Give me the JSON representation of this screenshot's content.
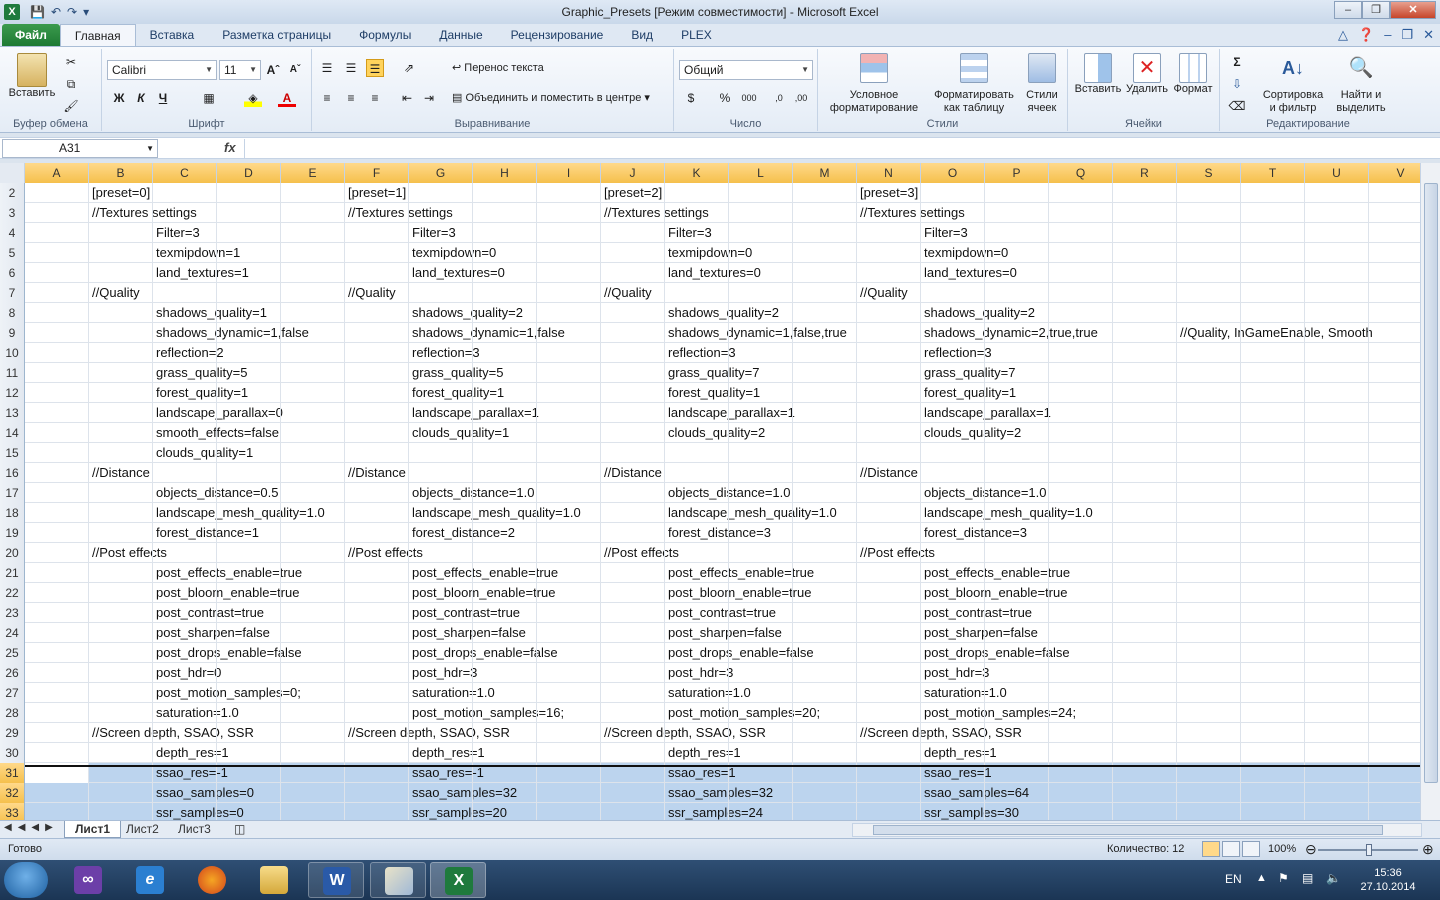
{
  "window": {
    "title": "Graphic_Presets  [Режим совместимости]  -  Microsoft Excel"
  },
  "ribbon_tabs": [
    "Файл",
    "Главная",
    "Вставка",
    "Разметка страницы",
    "Формулы",
    "Данные",
    "Рецензирование",
    "Вид",
    "PLEX"
  ],
  "ribbon": {
    "clipboard": {
      "paste": "Вставить",
      "label": "Буфер обмена"
    },
    "font": {
      "name": "Calibri",
      "size": "11",
      "label": "Шрифт"
    },
    "alignment": {
      "wrap": "Перенос текста",
      "merge": "Объединить и поместить в центре",
      "label": "Выравнивание"
    },
    "number": {
      "format": "Общий",
      "label": "Число"
    },
    "styles": {
      "conditional": "Условное форматирование",
      "as_table": "Форматировать как таблицу",
      "cell_styles": "Стили ячеек",
      "label": "Стили"
    },
    "cells": {
      "insert": "Вставить",
      "delete": "Удалить",
      "format": "Формат",
      "label": "Ячейки"
    },
    "editing": {
      "sort": "Сортировка и фильтр",
      "find": "Найти и выделить",
      "label": "Редактирование"
    }
  },
  "formula_bar": {
    "name_box": "A31",
    "fx": "fx",
    "formula": ""
  },
  "columns": [
    "A",
    "B",
    "C",
    "D",
    "E",
    "F",
    "G",
    "H",
    "I",
    "J",
    "K",
    "L",
    "M",
    "N",
    "O",
    "P",
    "Q",
    "R",
    "S",
    "T",
    "U",
    "V"
  ],
  "rows": [
    {
      "n": "2",
      "cells": [
        {
          "c": "B",
          "v": "[preset=0]"
        },
        {
          "c": "F",
          "v": "[preset=1]"
        },
        {
          "c": "J",
          "v": "[preset=2]"
        },
        {
          "c": "N",
          "v": "[preset=3]"
        }
      ]
    },
    {
      "n": "3",
      "cells": [
        {
          "c": "B",
          "v": "//Textures settings"
        },
        {
          "c": "F",
          "v": "//Textures settings"
        },
        {
          "c": "J",
          "v": "//Textures settings"
        },
        {
          "c": "N",
          "v": "//Textures settings"
        }
      ]
    },
    {
      "n": "4",
      "cells": [
        {
          "c": "C",
          "v": "Filter=3"
        },
        {
          "c": "G",
          "v": "Filter=3"
        },
        {
          "c": "K",
          "v": "Filter=3"
        },
        {
          "c": "O",
          "v": "Filter=3"
        }
      ]
    },
    {
      "n": "5",
      "cells": [
        {
          "c": "C",
          "v": "texmipdown=1"
        },
        {
          "c": "G",
          "v": "texmipdown=0"
        },
        {
          "c": "K",
          "v": "texmipdown=0"
        },
        {
          "c": "O",
          "v": "texmipdown=0"
        }
      ]
    },
    {
      "n": "6",
      "cells": [
        {
          "c": "C",
          "v": "land_textures=1"
        },
        {
          "c": "G",
          "v": "land_textures=0"
        },
        {
          "c": "K",
          "v": "land_textures=0"
        },
        {
          "c": "O",
          "v": "land_textures=0"
        }
      ]
    },
    {
      "n": "7",
      "cells": [
        {
          "c": "B",
          "v": "//Quality"
        },
        {
          "c": "F",
          "v": "//Quality"
        },
        {
          "c": "J",
          "v": "//Quality"
        },
        {
          "c": "N",
          "v": "//Quality"
        }
      ]
    },
    {
      "n": "8",
      "cells": [
        {
          "c": "C",
          "v": "shadows_quality=1"
        },
        {
          "c": "G",
          "v": "shadows_quality=2"
        },
        {
          "c": "K",
          "v": "shadows_quality=2"
        },
        {
          "c": "O",
          "v": "shadows_quality=2"
        }
      ]
    },
    {
      "n": "9",
      "cells": [
        {
          "c": "C",
          "v": "shadows_dynamic=1,false"
        },
        {
          "c": "G",
          "v": "shadows_dynamic=1,false"
        },
        {
          "c": "K",
          "v": "shadows_dynamic=1,false,true"
        },
        {
          "c": "O",
          "v": "shadows_dynamic=2,true,true"
        },
        {
          "c": "S",
          "v": "//Quality, InGameEnable, Smooth"
        }
      ]
    },
    {
      "n": "10",
      "cells": [
        {
          "c": "C",
          "v": "reflection=2"
        },
        {
          "c": "G",
          "v": "reflection=3"
        },
        {
          "c": "K",
          "v": "reflection=3"
        },
        {
          "c": "O",
          "v": "reflection=3"
        }
      ]
    },
    {
      "n": "11",
      "cells": [
        {
          "c": "C",
          "v": "grass_quality=5"
        },
        {
          "c": "G",
          "v": "grass_quality=5"
        },
        {
          "c": "K",
          "v": "grass_quality=7"
        },
        {
          "c": "O",
          "v": "grass_quality=7"
        }
      ]
    },
    {
      "n": "12",
      "cells": [
        {
          "c": "C",
          "v": "forest_quality=1"
        },
        {
          "c": "G",
          "v": "forest_quality=1"
        },
        {
          "c": "K",
          "v": "forest_quality=1"
        },
        {
          "c": "O",
          "v": "forest_quality=1"
        }
      ]
    },
    {
      "n": "13",
      "cells": [
        {
          "c": "C",
          "v": "landscape_parallax=0"
        },
        {
          "c": "G",
          "v": "landscape_parallax=1"
        },
        {
          "c": "K",
          "v": "landscape_parallax=1"
        },
        {
          "c": "O",
          "v": "landscape_parallax=1"
        }
      ]
    },
    {
      "n": "14",
      "cells": [
        {
          "c": "C",
          "v": "smooth_effects=false"
        },
        {
          "c": "G",
          "v": "clouds_quality=1"
        },
        {
          "c": "K",
          "v": "clouds_quality=2"
        },
        {
          "c": "O",
          "v": "clouds_quality=2"
        }
      ]
    },
    {
      "n": "15",
      "cells": [
        {
          "c": "C",
          "v": "clouds_quality=1"
        }
      ]
    },
    {
      "n": "16",
      "cells": [
        {
          "c": "B",
          "v": "//Distance"
        },
        {
          "c": "F",
          "v": "//Distance"
        },
        {
          "c": "J",
          "v": "//Distance"
        },
        {
          "c": "N",
          "v": "//Distance"
        }
      ]
    },
    {
      "n": "17",
      "cells": [
        {
          "c": "C",
          "v": "objects_distance=0.5"
        },
        {
          "c": "G",
          "v": "objects_distance=1.0"
        },
        {
          "c": "K",
          "v": "objects_distance=1.0"
        },
        {
          "c": "O",
          "v": "objects_distance=1.0"
        }
      ]
    },
    {
      "n": "18",
      "cells": [
        {
          "c": "C",
          "v": "landscape_mesh_quality=1.0"
        },
        {
          "c": "G",
          "v": "landscape_mesh_quality=1.0"
        },
        {
          "c": "K",
          "v": "landscape_mesh_quality=1.0"
        },
        {
          "c": "O",
          "v": "landscape_mesh_quality=1.0"
        }
      ]
    },
    {
      "n": "19",
      "cells": [
        {
          "c": "C",
          "v": "forest_distance=1"
        },
        {
          "c": "G",
          "v": "forest_distance=2"
        },
        {
          "c": "K",
          "v": "forest_distance=3"
        },
        {
          "c": "O",
          "v": "forest_distance=3"
        }
      ]
    },
    {
      "n": "20",
      "cells": [
        {
          "c": "B",
          "v": "//Post effects"
        },
        {
          "c": "F",
          "v": "//Post effects"
        },
        {
          "c": "J",
          "v": "//Post effects"
        },
        {
          "c": "N",
          "v": "//Post effects"
        }
      ]
    },
    {
      "n": "21",
      "cells": [
        {
          "c": "C",
          "v": "post_effects_enable=true"
        },
        {
          "c": "G",
          "v": "post_effects_enable=true"
        },
        {
          "c": "K",
          "v": "post_effects_enable=true"
        },
        {
          "c": "O",
          "v": "post_effects_enable=true"
        }
      ]
    },
    {
      "n": "22",
      "cells": [
        {
          "c": "C",
          "v": "post_bloom_enable=true"
        },
        {
          "c": "G",
          "v": "post_bloom_enable=true"
        },
        {
          "c": "K",
          "v": "post_bloom_enable=true"
        },
        {
          "c": "O",
          "v": "post_bloom_enable=true"
        }
      ]
    },
    {
      "n": "23",
      "cells": [
        {
          "c": "C",
          "v": "post_contrast=true"
        },
        {
          "c": "G",
          "v": "post_contrast=true"
        },
        {
          "c": "K",
          "v": "post_contrast=true"
        },
        {
          "c": "O",
          "v": "post_contrast=true"
        }
      ]
    },
    {
      "n": "24",
      "cells": [
        {
          "c": "C",
          "v": "post_sharpen=false"
        },
        {
          "c": "G",
          "v": "post_sharpen=false"
        },
        {
          "c": "K",
          "v": "post_sharpen=false"
        },
        {
          "c": "O",
          "v": "post_sharpen=false"
        }
      ]
    },
    {
      "n": "25",
      "cells": [
        {
          "c": "C",
          "v": "post_drops_enable=false"
        },
        {
          "c": "G",
          "v": "post_drops_enable=false"
        },
        {
          "c": "K",
          "v": "post_drops_enable=false"
        },
        {
          "c": "O",
          "v": "post_drops_enable=false"
        }
      ]
    },
    {
      "n": "26",
      "cells": [
        {
          "c": "C",
          "v": "post_hdr=0"
        },
        {
          "c": "G",
          "v": "post_hdr=3"
        },
        {
          "c": "K",
          "v": "post_hdr=3"
        },
        {
          "c": "O",
          "v": "post_hdr=3"
        }
      ]
    },
    {
      "n": "27",
      "cells": [
        {
          "c": "C",
          "v": "post_motion_samples=0;"
        },
        {
          "c": "G",
          "v": "saturation=1.0"
        },
        {
          "c": "K",
          "v": "saturation=1.0"
        },
        {
          "c": "O",
          "v": "saturation=1.0"
        }
      ]
    },
    {
      "n": "28",
      "cells": [
        {
          "c": "C",
          "v": "saturation=1.0"
        },
        {
          "c": "G",
          "v": "post_motion_samples=16;"
        },
        {
          "c": "K",
          "v": "post_motion_samples=20;"
        },
        {
          "c": "O",
          "v": "post_motion_samples=24;"
        }
      ]
    },
    {
      "n": "29",
      "cells": [
        {
          "c": "B",
          "v": "//Screen depth, SSAO, SSR"
        },
        {
          "c": "F",
          "v": "//Screen depth, SSAO, SSR"
        },
        {
          "c": "J",
          "v": "//Screen depth, SSAO, SSR"
        },
        {
          "c": "N",
          "v": "//Screen depth, SSAO, SSR"
        }
      ]
    },
    {
      "n": "30",
      "cells": [
        {
          "c": "C",
          "v": "depth_res=1"
        },
        {
          "c": "G",
          "v": "depth_res=1"
        },
        {
          "c": "K",
          "v": "depth_res=1"
        },
        {
          "c": "O",
          "v": "depth_res=1"
        }
      ]
    },
    {
      "n": "31",
      "sel": true,
      "cells": [
        {
          "c": "C",
          "v": "ssao_res=-1"
        },
        {
          "c": "G",
          "v": "ssao_res=-1"
        },
        {
          "c": "K",
          "v": "ssao_res=1"
        },
        {
          "c": "O",
          "v": "ssao_res=1"
        }
      ]
    },
    {
      "n": "32",
      "sel": true,
      "cells": [
        {
          "c": "C",
          "v": "ssao_samples=0"
        },
        {
          "c": "G",
          "v": "ssao_samples=32"
        },
        {
          "c": "K",
          "v": "ssao_samples=32"
        },
        {
          "c": "O",
          "v": "ssao_samples=64"
        }
      ]
    },
    {
      "n": "33",
      "sel": true,
      "cells": [
        {
          "c": "C",
          "v": "ssr_samples=0"
        },
        {
          "c": "G",
          "v": "ssr_samples=20"
        },
        {
          "c": "K",
          "v": "ssr_samples=24"
        },
        {
          "c": "O",
          "v": "ssr_samples=30"
        }
      ]
    }
  ],
  "sheets": [
    "Лист1",
    "Лист2",
    "Лист3"
  ],
  "status": {
    "ready": "Готово",
    "count": "Количество: 12",
    "zoom": "100%"
  },
  "taskbar": {
    "lang": "EN",
    "time": "15:36",
    "date": "27.10.2014"
  }
}
